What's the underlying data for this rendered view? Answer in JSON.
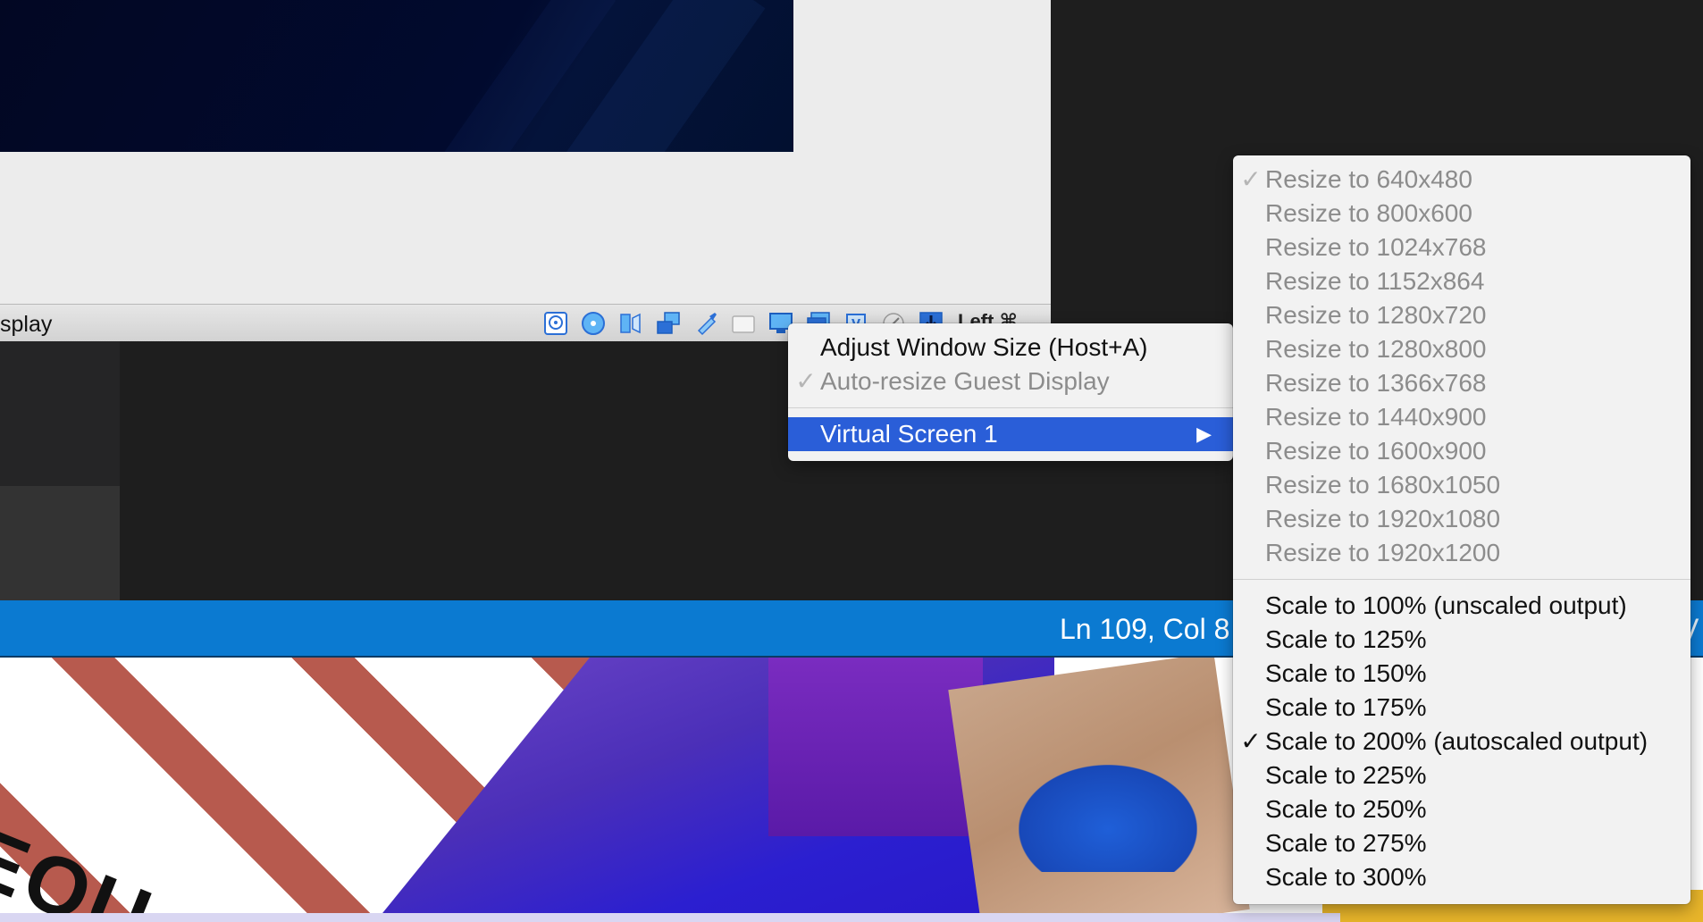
{
  "vm_statusbar": {
    "partial_label": "splay",
    "host_key": "Left ⌘"
  },
  "display_menu": {
    "items": [
      {
        "label": "Adjust Window Size (Host+A)",
        "enabled": true
      },
      {
        "label": "Auto-resize Guest Display",
        "enabled": false,
        "checked": true
      }
    ],
    "submenu_label": "Virtual Screen 1",
    "submenu_arrow": "▶"
  },
  "screen_menu": {
    "check_glyph": "✓",
    "resize_items": [
      {
        "label": "Resize to 640x480",
        "checked": true
      },
      {
        "label": "Resize to 800x600"
      },
      {
        "label": "Resize to 1024x768"
      },
      {
        "label": "Resize to 1152x864"
      },
      {
        "label": "Resize to 1280x720"
      },
      {
        "label": "Resize to 1280x800"
      },
      {
        "label": "Resize to 1366x768"
      },
      {
        "label": "Resize to 1440x900"
      },
      {
        "label": "Resize to 1600x900"
      },
      {
        "label": "Resize to 1680x1050"
      },
      {
        "label": "Resize to 1920x1080"
      },
      {
        "label": "Resize to 1920x1200"
      }
    ],
    "scale_items": [
      {
        "label": "Scale to 100% (unscaled output)"
      },
      {
        "label": "Scale to 125%"
      },
      {
        "label": "Scale to 150%"
      },
      {
        "label": "Scale to 175%"
      },
      {
        "label": "Scale to 200% (autoscaled output)",
        "checked": true
      },
      {
        "label": "Scale to 225%"
      },
      {
        "label": "Scale to 250%"
      },
      {
        "label": "Scale to 275%"
      },
      {
        "label": "Scale to 300%"
      }
    ]
  },
  "editor_status": {
    "cursor_position": "Ln 109, Col 8",
    "right_partial": "V"
  },
  "background_image": {
    "partial_word": "EOU"
  },
  "colors": {
    "highlight": "#2a5ed8",
    "status_bar": "#0b7ad1",
    "editor_bg": "#1e1e1e",
    "menu_bg": "#f2f2f2",
    "disabled_text": "#8c8c8c"
  },
  "icons": [
    "hard-disk-icon",
    "optical-drive-icon",
    "audio-icon",
    "network-icon",
    "usb-icon",
    "shared-folder-icon",
    "display-icon",
    "recording-icon",
    "cpu-icon",
    "mouse-integration-icon",
    "keyboard-icon"
  ]
}
